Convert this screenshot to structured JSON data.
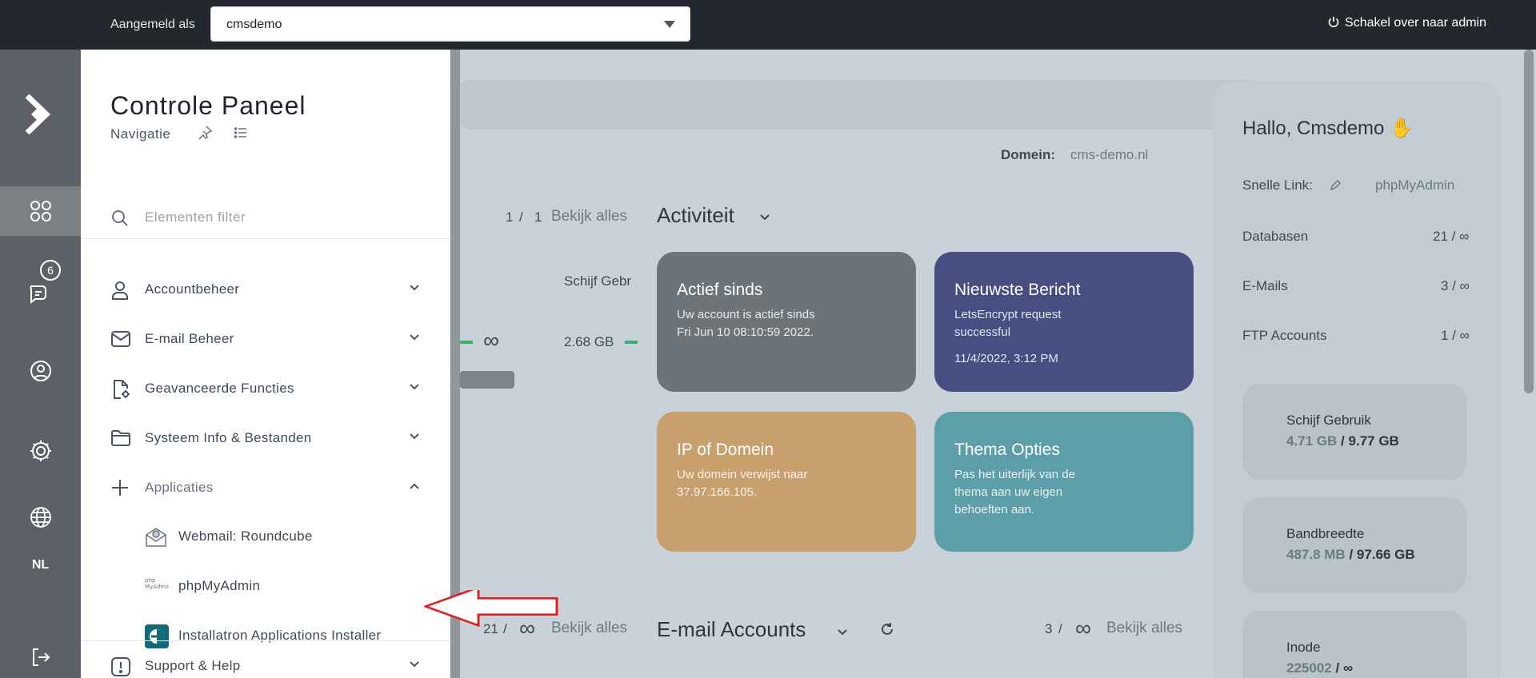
{
  "topbar": {
    "logged_in_label": "Aangemeld als",
    "account_value": "cmsdemo",
    "switch_admin": "Schakel over naar admin"
  },
  "rail": {
    "messages_badge": "6",
    "language": "NL"
  },
  "nav": {
    "title": "Controle Paneel",
    "subtitle": "Navigatie",
    "filter_placeholder": "Elementen filter",
    "items": [
      {
        "label": "Accountbeheer"
      },
      {
        "label": "E-mail Beheer"
      },
      {
        "label": "Geavanceerde Functies"
      },
      {
        "label": "Systeem Info & Bestanden"
      },
      {
        "label": "Applicaties"
      },
      {
        "label": "Support & Help"
      }
    ],
    "apps": [
      {
        "label": "Webmail: Roundcube"
      },
      {
        "label": "phpMyAdmin"
      },
      {
        "label": "Installatron Applications Installer"
      }
    ]
  },
  "dashboard": {
    "domain_label": "Domein:",
    "domain_value": "cms-demo.nl",
    "domains_count": "1",
    "domains_total": "1",
    "view_all": "Bekijk alles",
    "disk_header": "Schijf Gebr",
    "disk_value": "2.68 GB",
    "activity_title": "Activiteit",
    "cards": [
      {
        "title": "Actief sinds",
        "text": "Uw account is actief sinds Fri Jun 10 08:10:59 2022.",
        "color": "#6c7479"
      },
      {
        "title": "Nieuwste Bericht",
        "text": "LetsEncrypt request successful",
        "date": "11/4/2022, 3:12 PM",
        "color": "#464e82"
      },
      {
        "title": "IP of Domein",
        "text": "Uw domein verwijst naar 37.97.166.105.",
        "color": "#c7a06e"
      },
      {
        "title": "Thema Opties",
        "text": "Pas het uiterlijk van de thema aan uw eigen behoeften aan.",
        "color": "#5d9fa8"
      }
    ],
    "email_title": "E-mail Accounts",
    "email_count": "3",
    "left_count": "21",
    "greeting": "Hallo, Cmsdemo",
    "quick_link_label": "Snelle Link:",
    "quick_link_value": "phpMyAdmin",
    "rows": [
      {
        "label": "Databasen",
        "value": "21 / ∞"
      },
      {
        "label": "E-Mails",
        "value": "3 / ∞"
      },
      {
        "label": "FTP Accounts",
        "value": "1 / ∞"
      }
    ],
    "disk_usage": {
      "label": "Schijf Gebruik",
      "used": "4.71 GB",
      "total": "9.77 GB"
    },
    "bandwidth": {
      "label": "Bandbreedte",
      "used": "487.8 MB",
      "total": "97.66 GB"
    },
    "inode": {
      "label": "Inode",
      "used": "225002",
      "total": "∞"
    }
  }
}
